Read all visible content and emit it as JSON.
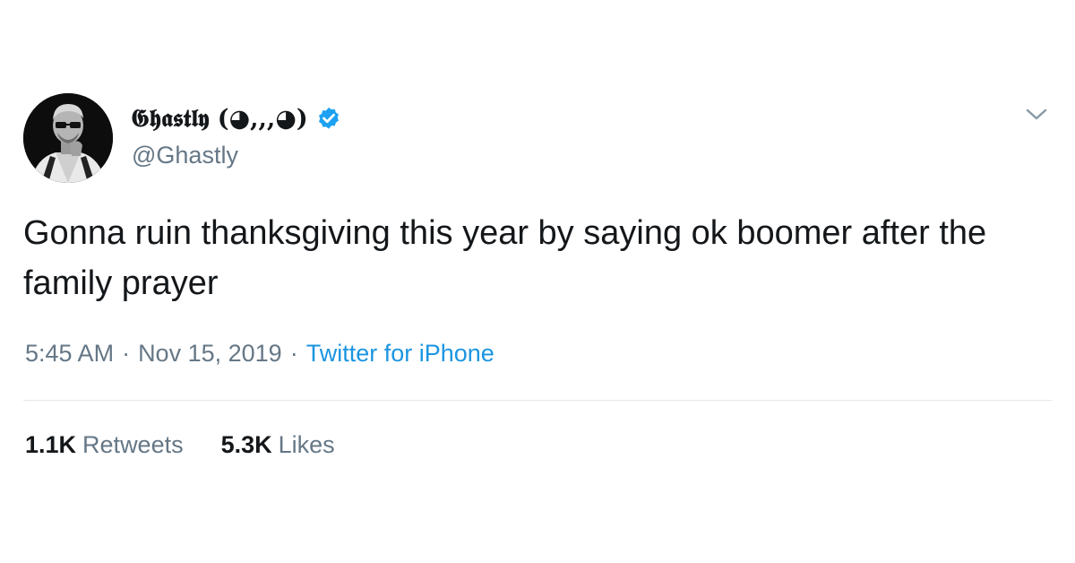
{
  "author": {
    "display_name": "𝕲𝖍𝖆𝖘𝖙𝖑𝖞 (◕,,,◕)",
    "handle": "@Ghastly",
    "verified": true,
    "avatar_icon": "profile-photo"
  },
  "tweet": {
    "text": "Gonna ruin thanksgiving this year by saying ok boomer after the family prayer",
    "time": "5:45 AM",
    "separator": "·",
    "date": "Nov 15, 2019",
    "source": "Twitter for iPhone"
  },
  "stats": {
    "retweets_count": "1.1K",
    "retweets_label": "Retweets",
    "likes_count": "5.3K",
    "likes_label": "Likes"
  },
  "colors": {
    "text_primary": "#14171a",
    "text_secondary": "#657786",
    "link": "#1b95e0",
    "verified": "#1da1f2",
    "divider": "#e1e8ed"
  },
  "icons": {
    "verified": "verified-badge-icon",
    "menu": "chevron-down-icon"
  }
}
